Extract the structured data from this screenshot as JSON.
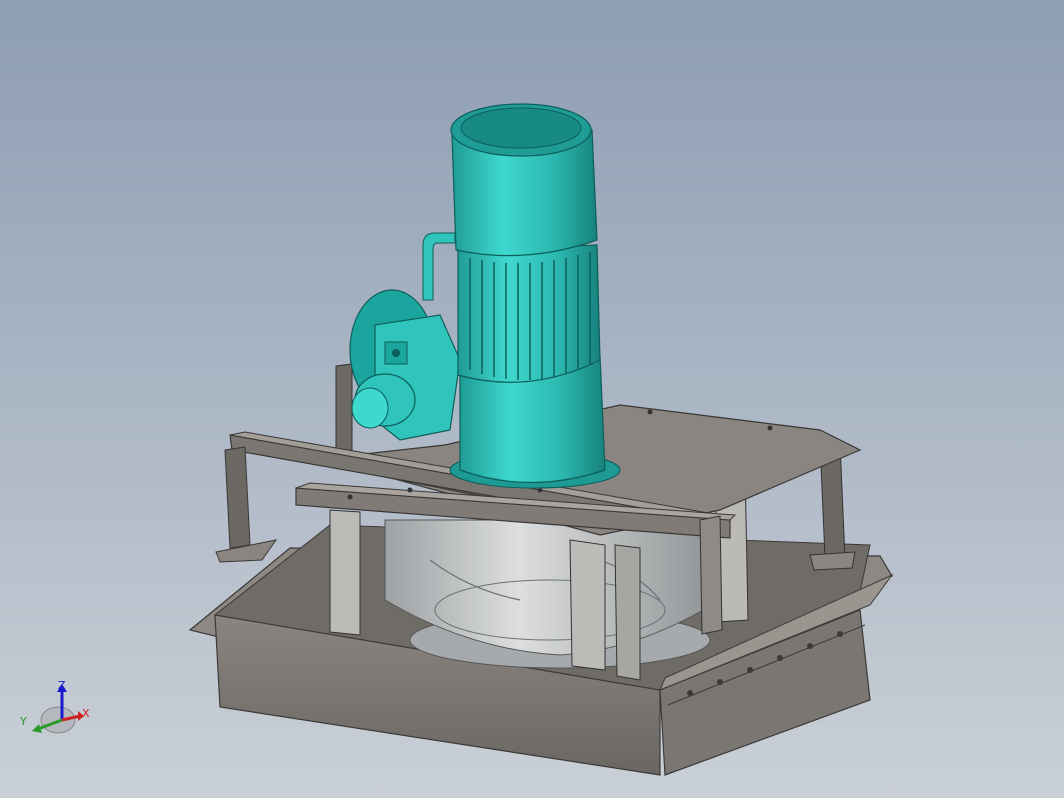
{
  "viewport": {
    "background_top": "#8d9db3",
    "background_bottom": "#c9cfd7"
  },
  "model": {
    "motor_color": "#2fc4bc",
    "motor_dark": "#14807a",
    "frame_color": "#7d7873",
    "frame_dark": "#54504c",
    "fan_color": "#b9bcbe"
  },
  "triad": {
    "z_label": "Z",
    "x_label": "X",
    "y_label": "Y",
    "z_color": "#1a1ad0",
    "x_color": "#d02020",
    "y_color": "#2a9a2a"
  }
}
